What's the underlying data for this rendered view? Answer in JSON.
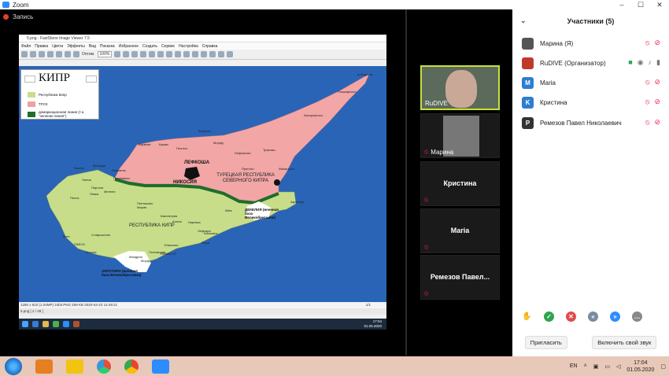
{
  "window": {
    "title": "Zoom",
    "controls": [
      "–",
      "☐",
      "✕"
    ]
  },
  "recording": {
    "label": "Запись"
  },
  "image_viewer": {
    "title": "5.png - FastStone Image Viewer 7.5",
    "menu": [
      "Файл",
      "Правка",
      "Цвета",
      "Эффекты",
      "Вид",
      "Показка",
      "Избранное",
      "Создать",
      "Сервис",
      "Настройка",
      "Справка"
    ],
    "fit_label": "Оптим.",
    "zoom_value": "100%",
    "status": "1280 x 810 (1.04MP)  24bit PNG  209 KB  2020-04-22 14:49:21",
    "status2": "5.png [ 2 / 28 ]",
    "page": "1/1"
  },
  "map": {
    "title": "КИПР",
    "legend": [
      {
        "label": "Республика Кипр",
        "color": "#c8dd8a"
      },
      {
        "label": "ТРСК",
        "color": "#f0a0a0"
      },
      {
        "label": "демаркационная линия (т.н. \"зеленая линия\")",
        "color": "#1e6e2c"
      }
    ],
    "regions": {
      "north": "ТУРЕЦКАЯ РЕСПУБЛИКА СЕВЕРНОГО КИПРА",
      "south": "РЕСПУБЛИКА КИПР",
      "nicosia": "НИКОСИЯ",
      "lefkosha": "ЛЕФКОША"
    },
    "cities": [
      "м.Андреас",
      "Ризокарпасо",
      "Аисоркеросо",
      "Кирения",
      "Кармиат",
      "Карми",
      "Геоглос",
      "Морфу",
      "Лефконико",
      "Трикомо",
      "Престно",
      "Фамагуста",
      "Кокине",
      "Мансура",
      "Лимнитис",
      "Пахиеммос",
      "Полис",
      "Пиния",
      "Пирголя",
      "Левка",
      "Мелели",
      "Маран",
      "Пентакомо",
      "Какопетрия",
      "Алона",
      "Айос",
      "Ларнака",
      "Лефкара",
      "Мари",
      "Ставроконно",
      "Агиасмос",
      "Китп",
      "ПАФОС",
      "Колона",
      "Мандрия",
      "Епископи",
      "Морфу",
      "Полемидия",
      "ЛИМАСОЛ",
      "Акротири",
      "Паралимни"
    ],
    "bases": {
      "akrotiri": "АКРОТИРИ (военная база Великобритании)",
      "dekelia": "ДЕКЕЛИЯ (военная база Великобритании)"
    }
  },
  "inner_taskbar": {
    "time": "17:04",
    "date": "01.05.2020",
    "lang": "ENG"
  },
  "video_tiles": [
    {
      "name": "RuDIVE",
      "muted": false,
      "active": true
    },
    {
      "name": "Марина",
      "muted": true,
      "active": false
    },
    {
      "name": "Кристина",
      "muted": true,
      "active": false
    },
    {
      "name": "Maria",
      "muted": true,
      "active": false
    },
    {
      "name": "Ремезов Павел...",
      "muted": true,
      "active": false
    }
  ],
  "participants_panel": {
    "title": "Участники (5)",
    "participants": [
      {
        "name": "Марина (Я)",
        "avatar": "",
        "color": "#555555"
      },
      {
        "name": "RuDIVE (Организатор)",
        "avatar": "",
        "color": "#c0392b"
      },
      {
        "name": "Maria",
        "avatar": "M",
        "color": "#2d7dd2"
      },
      {
        "name": "Кристина",
        "avatar": "K",
        "color": "#2d7dd2"
      },
      {
        "name": "Ремезов Павел Николаевич",
        "avatar": "P",
        "color": "#333333"
      }
    ],
    "invite_label": "Пригласить",
    "unmute_label": "Включить свой звук"
  },
  "taskbar": {
    "lang": "EN",
    "time": "17:04",
    "date": "01.05.2020"
  }
}
